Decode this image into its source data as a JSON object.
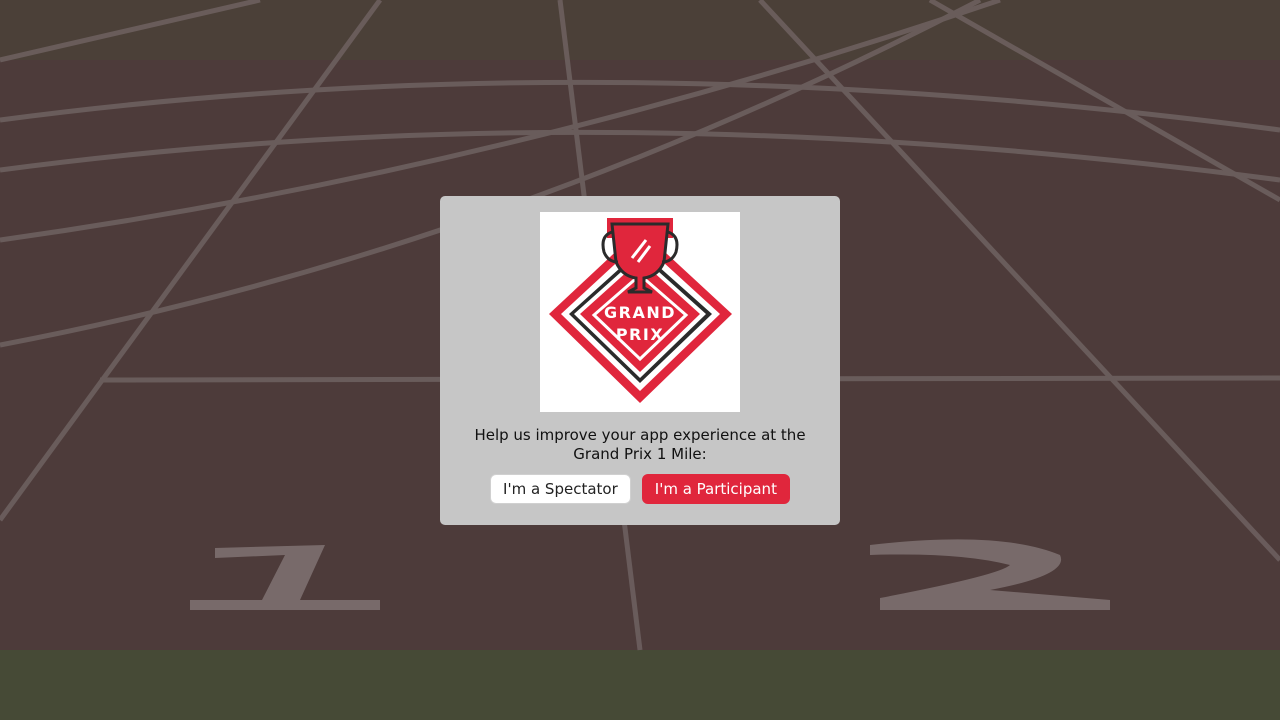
{
  "modal": {
    "logo": {
      "icon": "grand-prix-trophy-logo",
      "text_line1": "GRAND",
      "text_line2": "PRIX",
      "color": "#e0263c"
    },
    "prompt": "Help us improve your app experience at the Grand Prix 1 Mile:",
    "buttons": {
      "spectator_label": "I'm a Spectator",
      "participant_label": "I'm a Participant"
    }
  },
  "colors": {
    "accent": "#e0263c",
    "modal_bg": "#c6c6c6",
    "track": "#4e3a39"
  }
}
